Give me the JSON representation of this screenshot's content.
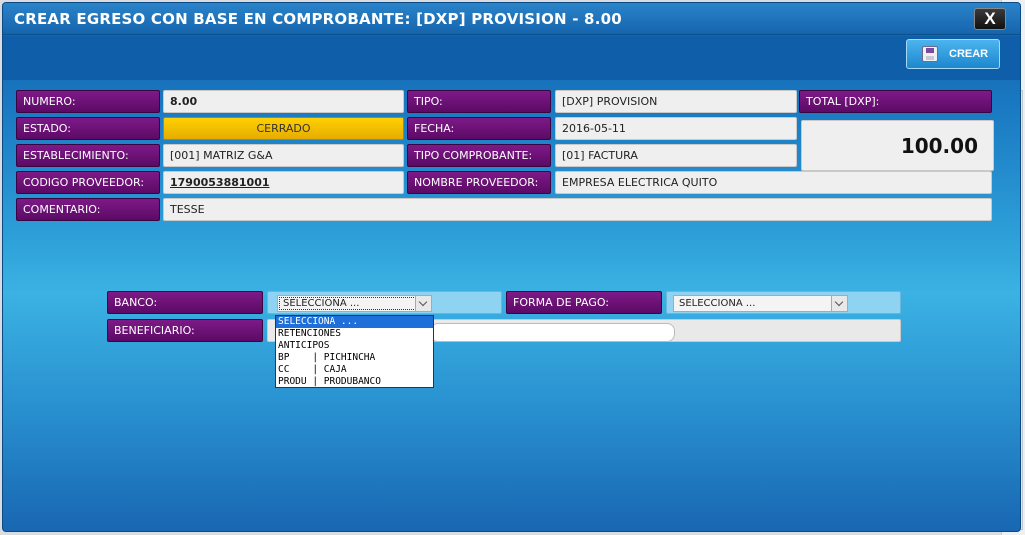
{
  "modal": {
    "title": "CREAR EGRESO CON BASE EN COMPROBANTE: [DXP] PROVISION - 8.00",
    "close_label": "X",
    "crear_label": "CREAR"
  },
  "fields": {
    "numero": {
      "label": "NUMERO:",
      "value": "8.00"
    },
    "estado": {
      "label": "ESTADO:",
      "value": "CERRADO"
    },
    "establecimiento": {
      "label": "ESTABLECIMIENTO:",
      "value": "[001] MATRIZ G&A"
    },
    "codigo_proveedor": {
      "label": "CODIGO PROVEEDOR:",
      "value": "1790053881001"
    },
    "comentario": {
      "label": "COMENTARIO:",
      "value": "TESSE"
    },
    "tipo": {
      "label": "TIPO:",
      "value": "[DXP] PROVISION"
    },
    "fecha": {
      "label": "FECHA:",
      "value": "2016-05-11"
    },
    "tipo_comprobante": {
      "label": "TIPO COMPROBANTE:",
      "value": "[01] FACTURA"
    },
    "nombre_proveedor": {
      "label": "NOMBRE PROVEEDOR:",
      "value": "EMPRESA ELECTRICA QUITO"
    },
    "total": {
      "label": "TOTAL [DXP]:",
      "value": "100.00"
    }
  },
  "payment": {
    "banco_label": "BANCO:",
    "banco_selected": "SELECCIONA ...",
    "forma_pago_label": "FORMA DE PAGO:",
    "forma_pago_selected": "SELECCIONA ...",
    "beneficiario_label": "BENEFICIARIO:",
    "beneficiario_value": ""
  },
  "banco_options": [
    "SELECCIONA ...",
    "RETENCIONES",
    "ANTICIPOS",
    "BP    | PICHINCHA",
    "CC    | CAJA",
    "PRODU | PRODUBANCO"
  ]
}
